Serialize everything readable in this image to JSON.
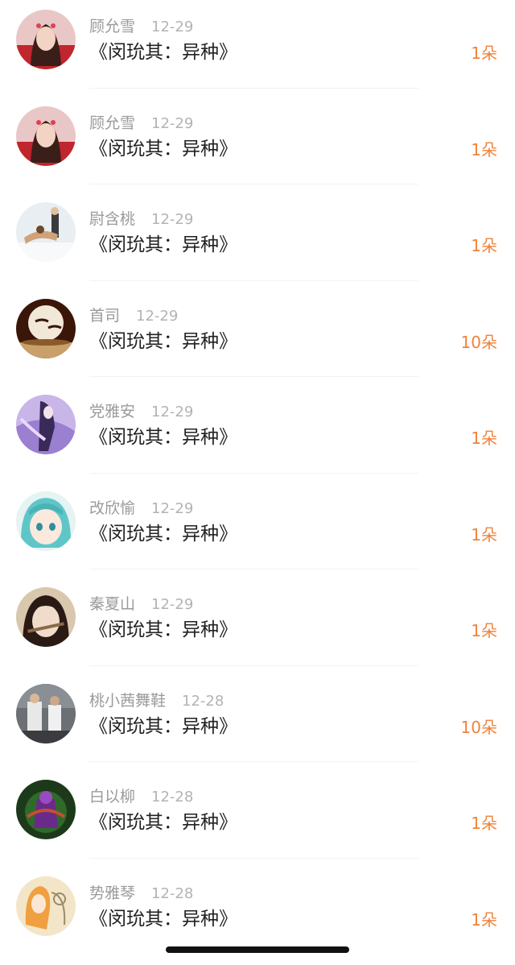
{
  "items": [
    {
      "name": "顾允雪",
      "date": "12-29",
      "title": "《闵玧其：异种》",
      "gift": "1朵",
      "avatar": "portrait-woman-red"
    },
    {
      "name": "顾允雪",
      "date": "12-29",
      "title": "《闵玧其：异种》",
      "gift": "1朵",
      "avatar": "portrait-woman-red"
    },
    {
      "name": "尉含桃",
      "date": "12-29",
      "title": "《闵玧其：异种》",
      "gift": "1朵",
      "avatar": "skating-pair"
    },
    {
      "name": "首司",
      "date": "12-29",
      "title": "《闵玧其：异种》",
      "gift": "10朵",
      "avatar": "moon-illustration"
    },
    {
      "name": "党雅安",
      "date": "12-29",
      "title": "《闵玧其：异种》",
      "gift": "1朵",
      "avatar": "purple-anime-girl"
    },
    {
      "name": "改欣愉",
      "date": "12-29",
      "title": "《闵玧其：异种》",
      "gift": "1朵",
      "avatar": "teal-hair-anime"
    },
    {
      "name": "秦夏山",
      "date": "12-29",
      "title": "《闵玧其：异种》",
      "gift": "1朵",
      "avatar": "dark-hair-anime"
    },
    {
      "name": "桃小茜舞鞋",
      "date": "12-28",
      "title": "《闵玧其：异种》",
      "gift": "10朵",
      "avatar": "street-photo"
    },
    {
      "name": "白以柳",
      "date": "12-28",
      "title": "《闵玧其：异种》",
      "gift": "1朵",
      "avatar": "game-character"
    },
    {
      "name": "势雅琴",
      "date": "12-28",
      "title": "《闵玧其：异种》",
      "gift": "1朵",
      "avatar": "sketch-illustration"
    }
  ]
}
